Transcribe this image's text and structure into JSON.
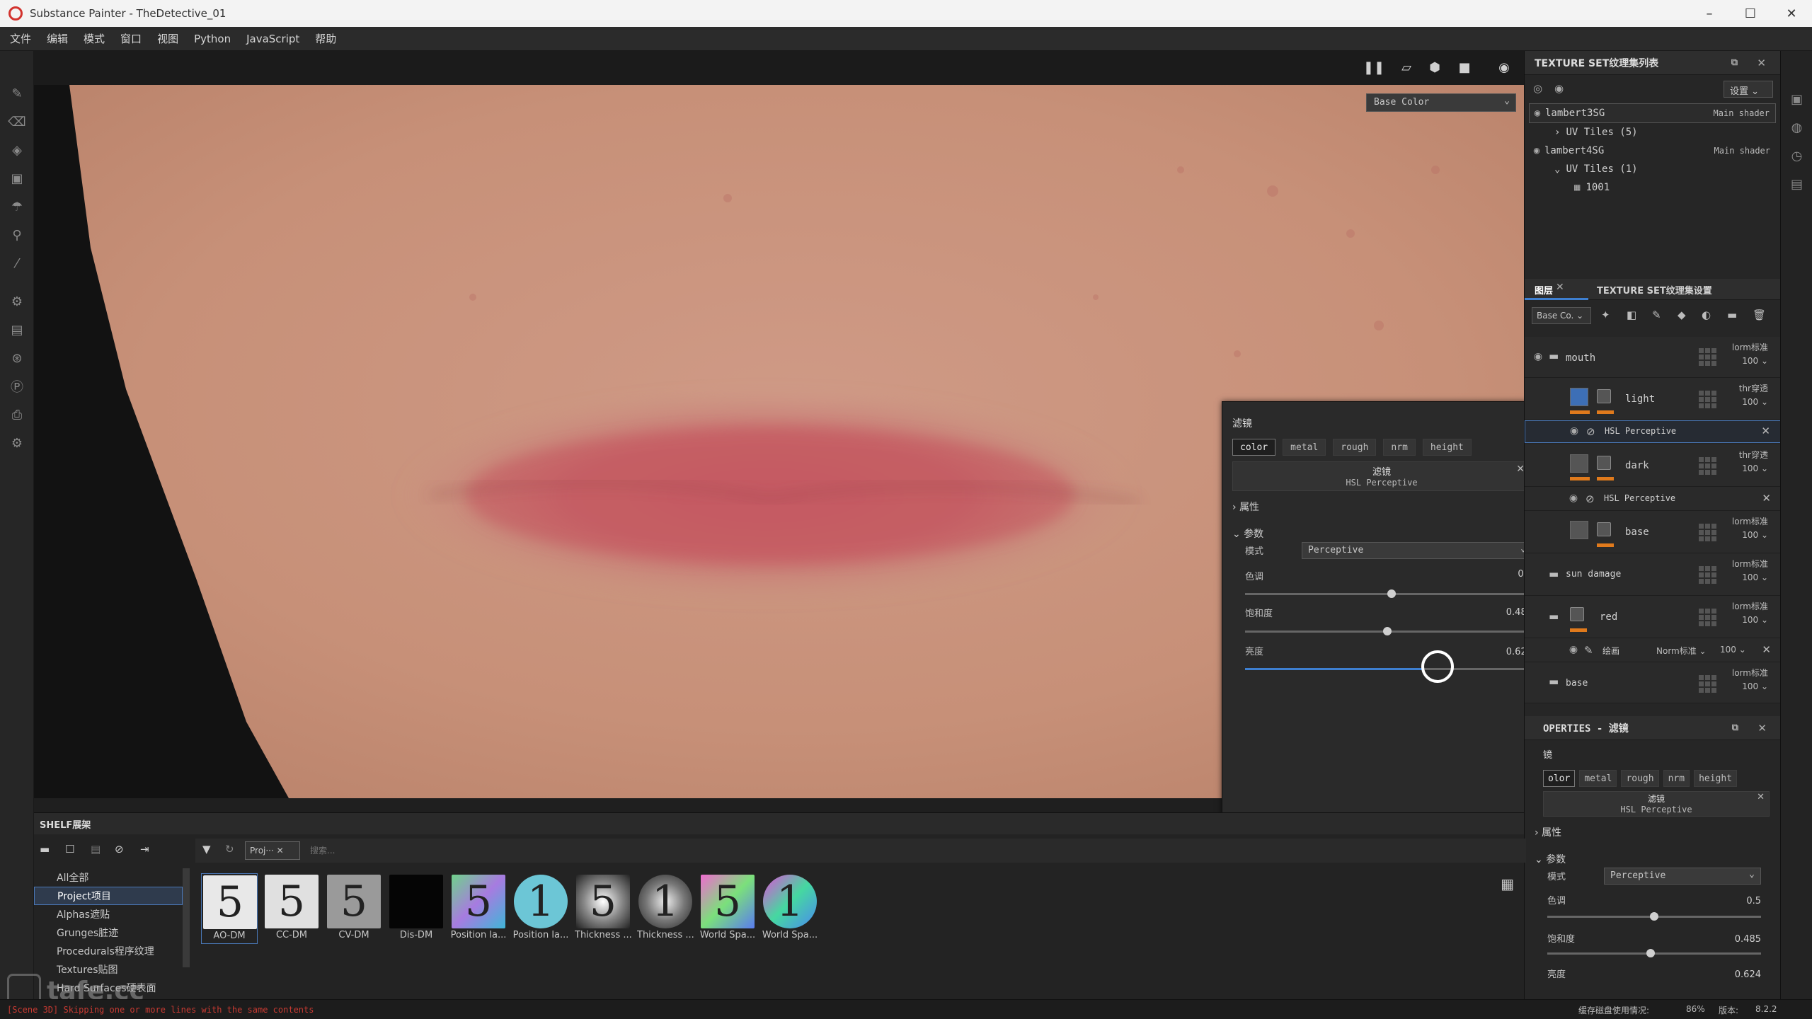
{
  "window": {
    "title": "Substance Painter - TheDetective_01",
    "min": "–",
    "max": "☐",
    "close": "✕"
  },
  "menu": [
    "文件",
    "编辑",
    "模式",
    "窗口",
    "视图",
    "Python",
    "JavaScript",
    "帮助"
  ],
  "viewport": {
    "channel": "Base Color",
    "channel_caret": "⌄"
  },
  "texture_sets": {
    "title": "TEXTURE SET纹理集列表",
    "settings_label": "设置",
    "items": [
      {
        "name": "lambert3SG",
        "shader": "Main shader",
        "uv": "UV Tiles (5)"
      },
      {
        "name": "lambert4SG",
        "shader": "Main shader",
        "uv": "UV Tiles (1)",
        "tile": "1001"
      }
    ]
  },
  "layers_panel": {
    "tab_layers": "图层",
    "tab_settings": "TEXTURE SET纹理集设置",
    "channel": "Base Co.",
    "layers": [
      {
        "name": "mouth",
        "blend": "lorm标准",
        "opacity": "100"
      },
      {
        "name": "light",
        "blend": "thr穿透",
        "opacity": "100"
      },
      {
        "name": "HSL Perceptive"
      },
      {
        "name": "dark",
        "blend": "thr穿透",
        "opacity": "100"
      },
      {
        "name": "HSL Perceptive"
      },
      {
        "name": "base",
        "blend": "lorm标准",
        "opacity": "100"
      },
      {
        "name": "sun damage",
        "blend": "lorm标准",
        "opacity": "100"
      },
      {
        "name": "red",
        "blend": "lorm标准",
        "opacity": "100"
      },
      {
        "name": "绘画",
        "blend": "Norm标准",
        "opacity": "100"
      },
      {
        "name": "base",
        "blend": "lorm标准",
        "opacity": "100"
      }
    ]
  },
  "filter_popup": {
    "title": "滤镜",
    "channels": [
      "color",
      "metal",
      "rough",
      "nrm",
      "height"
    ],
    "filter_label": "滤镜",
    "filter_name": "HSL Perceptive",
    "section_attr": "属性",
    "section_params": "参数",
    "mode_label": "模式",
    "mode_value": "Perceptive",
    "hue_label": "色调",
    "hue_value": "0.5",
    "sat_label": "饱和度",
    "sat_value": "0.485",
    "light_label": "亮度",
    "light_value": "0.624"
  },
  "properties": {
    "title": "OPERTIES - 滤镜",
    "section": "镜",
    "channels": [
      "olor",
      "metal",
      "rough",
      "nrm",
      "height"
    ],
    "filter_label": "滤镜",
    "filter_name": "HSL Perceptive",
    "section_attr": "属性",
    "section_params": "参数",
    "mode_label": "模式",
    "mode_value": "Perceptive",
    "hue_label": "色调",
    "hue_value": "0.5",
    "sat_label": "饱和度",
    "sat_value": "0.485",
    "light_label": "亮度",
    "light_value": "0.624"
  },
  "shelf": {
    "title": "SHELF展架",
    "tab": "Proj···",
    "search_placeholder": "搜索...",
    "categories": [
      "All全部",
      "Project项目",
      "Alphas遮贴",
      "Grunges脏迹",
      "Procedurals程序纹理",
      "Textures贴图",
      "Hard Surfaces硬表面"
    ],
    "assets": [
      {
        "label": "AO-DM",
        "glyph": "5"
      },
      {
        "label": "CC-DM",
        "glyph": "5"
      },
      {
        "label": "CV-DM",
        "glyph": "5"
      },
      {
        "label": "Dis-DM",
        "glyph": ""
      },
      {
        "label": "Position la...",
        "glyph": "5"
      },
      {
        "label": "Position la...",
        "glyph": "1"
      },
      {
        "label": "Thickness ...",
        "glyph": "5"
      },
      {
        "label": "Thickness ...",
        "glyph": "1"
      },
      {
        "label": "World Spa...",
        "glyph": "5"
      },
      {
        "label": "World Spa...",
        "glyph": "1"
      }
    ]
  },
  "status": {
    "log": "[Scene 3D] Skipping one or more lines with the same contents",
    "disk": "缓存磁盘使用情况:",
    "percent": "86%",
    "version_label": "版本:",
    "version": "8.2.2"
  },
  "watermark": "tafe.cc",
  "colors": {
    "accent": "#3e7fd0",
    "orange": "#e07a1c",
    "error": "#c83a32"
  }
}
